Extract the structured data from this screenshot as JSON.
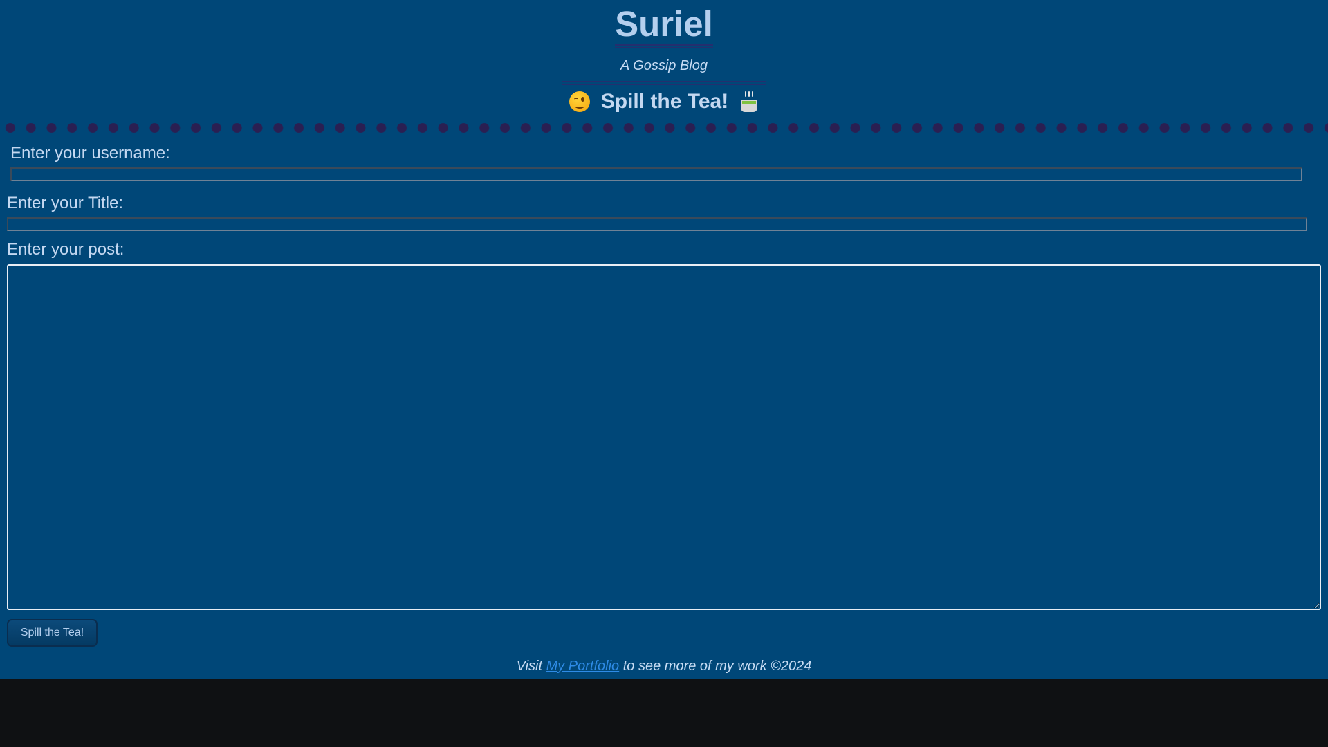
{
  "header": {
    "site_title": "Suriel",
    "tagline": "A Gossip Blog",
    "section_heading": "Spill the Tea!",
    "heading_icons": [
      "wink-emoji-icon",
      "tea-cup-icon"
    ]
  },
  "form": {
    "username_label": "Enter your username:",
    "username_value": "",
    "title_label": "Enter your Title:",
    "title_value": "",
    "post_label": "Enter your post:",
    "post_value": "",
    "submit_label": "Spill the Tea!"
  },
  "footer": {
    "prefix": "Visit ",
    "link_text": "My Portfolio",
    "suffix": " to see more of my work ©2024"
  },
  "colors": {
    "page_background": "#004778",
    "text": "#b4cfee",
    "accent_dots": "#2a1f52",
    "link": "#2e8be6",
    "outside_background": "#0f1113"
  }
}
